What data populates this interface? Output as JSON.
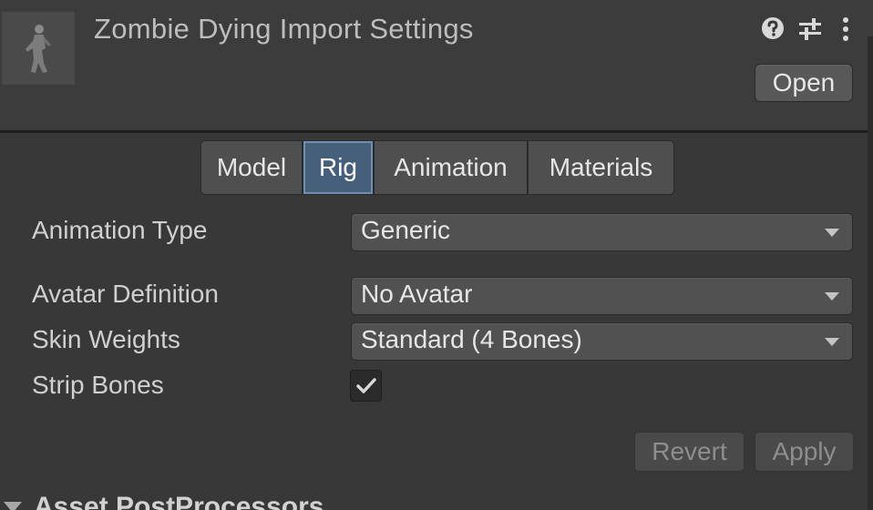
{
  "header": {
    "title": "Zombie Dying Import Settings",
    "open_label": "Open",
    "icons": [
      "help-icon",
      "presets-icon",
      "kebab-menu-icon"
    ]
  },
  "tabs": [
    {
      "label": "Model",
      "active": false
    },
    {
      "label": "Rig",
      "active": true
    },
    {
      "label": "Animation",
      "active": false
    },
    {
      "label": "Materials",
      "active": false
    }
  ],
  "rig": {
    "animation_type": {
      "label": "Animation Type",
      "value": "Generic"
    },
    "avatar_definition": {
      "label": "Avatar Definition",
      "value": "No Avatar"
    },
    "skin_weights": {
      "label": "Skin Weights",
      "value": "Standard (4 Bones)"
    },
    "strip_bones": {
      "label": "Strip Bones",
      "checked": true
    }
  },
  "actions": {
    "revert_label": "Revert",
    "apply_label": "Apply"
  },
  "footer": {
    "section_title": "Asset PostProcessors"
  },
  "colors": {
    "background": "#383838",
    "active_tab": "#46607c",
    "active_tab_border": "#6f8fb5"
  }
}
